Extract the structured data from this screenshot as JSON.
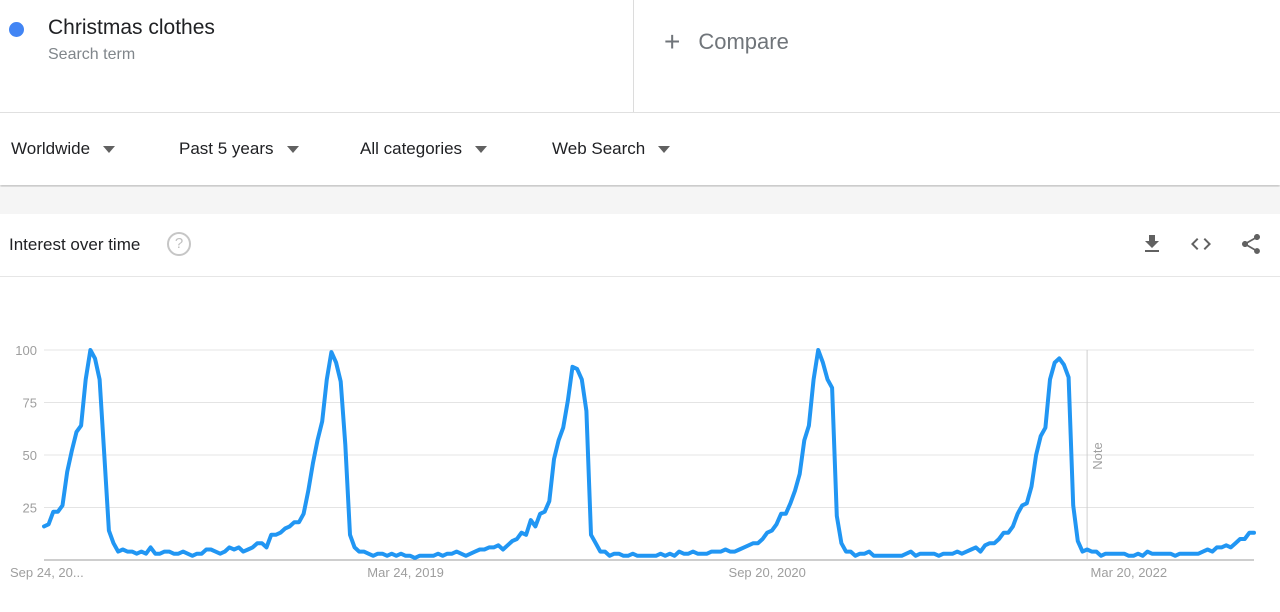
{
  "header": {
    "term": {
      "name": "Christmas clothes",
      "sublabel": "Search term",
      "color": "#4285f4"
    },
    "compare": {
      "icon": "plus-icon",
      "label": "Compare"
    }
  },
  "filters": [
    {
      "label": "Worldwide",
      "icon": "caret-down-icon"
    },
    {
      "label": "Past 5 years",
      "icon": "caret-down-icon"
    },
    {
      "label": "All categories",
      "icon": "caret-down-icon"
    },
    {
      "label": "Web Search",
      "icon": "caret-down-icon"
    }
  ],
  "card": {
    "title": "Interest over time",
    "help_icon": "help-circle-icon",
    "help_glyph": "?",
    "actions": [
      {
        "name": "download",
        "icon": "download-icon"
      },
      {
        "name": "embed",
        "icon": "code-embed-icon"
      },
      {
        "name": "share",
        "icon": "share-icon"
      }
    ]
  },
  "chart_data": {
    "type": "line",
    "title": "Interest over time",
    "xlabel": "",
    "ylabel": "",
    "ylim": [
      0,
      100
    ],
    "yticks": [
      25,
      50,
      75,
      100
    ],
    "ytick_labels": [
      "25",
      "50",
      "75",
      "100"
    ],
    "xtick_labels": [
      "Sep 24, 20...",
      "Mar 24, 2019",
      "Sep 20, 2020",
      "Mar 20, 2022"
    ],
    "xtick_positions_index": [
      0,
      78,
      156,
      234
    ],
    "grid": true,
    "legend": "none",
    "annotation": {
      "label": "Note",
      "index": 225
    },
    "series": [
      {
        "name": "Christmas clothes",
        "color": "#2196f3",
        "values": [
          16,
          17,
          23,
          23,
          26,
          42,
          52,
          61,
          64,
          86,
          100,
          96,
          86,
          50,
          14,
          8,
          4,
          5,
          4,
          4,
          3,
          4,
          3,
          6,
          3,
          3,
          4,
          4,
          3,
          3,
          4,
          3,
          2,
          3,
          3,
          5,
          5,
          4,
          3,
          4,
          6,
          5,
          6,
          4,
          5,
          6,
          8,
          8,
          6,
          12,
          12,
          13,
          15,
          16,
          18,
          18,
          22,
          33,
          46,
          57,
          66,
          86,
          99,
          94,
          85,
          55,
          12,
          6,
          4,
          4,
          3,
          2,
          3,
          3,
          2,
          3,
          2,
          3,
          2,
          2,
          1,
          2,
          2,
          2,
          2,
          3,
          2,
          3,
          3,
          4,
          3,
          2,
          3,
          4,
          5,
          5,
          6,
          6,
          7,
          5,
          7,
          9,
          10,
          13,
          12,
          19,
          16,
          22,
          23,
          28,
          48,
          57,
          63,
          76,
          92,
          91,
          86,
          71,
          12,
          8,
          4,
          4,
          2,
          3,
          3,
          2,
          2,
          3,
          2,
          2,
          2,
          2,
          2,
          3,
          2,
          3,
          2,
          4,
          3,
          3,
          4,
          3,
          3,
          3,
          4,
          4,
          4,
          5,
          4,
          4,
          5,
          6,
          7,
          8,
          8,
          10,
          13,
          14,
          17,
          22,
          22,
          27,
          33,
          41,
          57,
          64,
          86,
          100,
          94,
          86,
          82,
          21,
          8,
          4,
          4,
          2,
          3,
          3,
          4,
          2,
          2,
          2,
          2,
          2,
          2,
          2,
          3,
          4,
          2,
          3,
          3,
          3,
          3,
          2,
          3,
          3,
          3,
          4,
          3,
          4,
          5,
          6,
          4,
          7,
          8,
          8,
          10,
          13,
          13,
          16,
          22,
          26,
          27,
          35,
          50,
          59,
          63,
          86,
          94,
          96,
          93,
          87,
          26,
          9,
          4,
          5,
          4,
          4,
          2,
          3,
          3,
          3,
          3,
          3,
          2,
          2,
          3,
          2,
          4,
          3,
          3,
          3,
          3,
          3,
          2,
          3,
          3,
          3,
          3,
          3,
          4,
          5,
          4,
          6,
          6,
          7,
          6,
          8,
          10,
          10,
          13,
          13
        ]
      }
    ]
  }
}
